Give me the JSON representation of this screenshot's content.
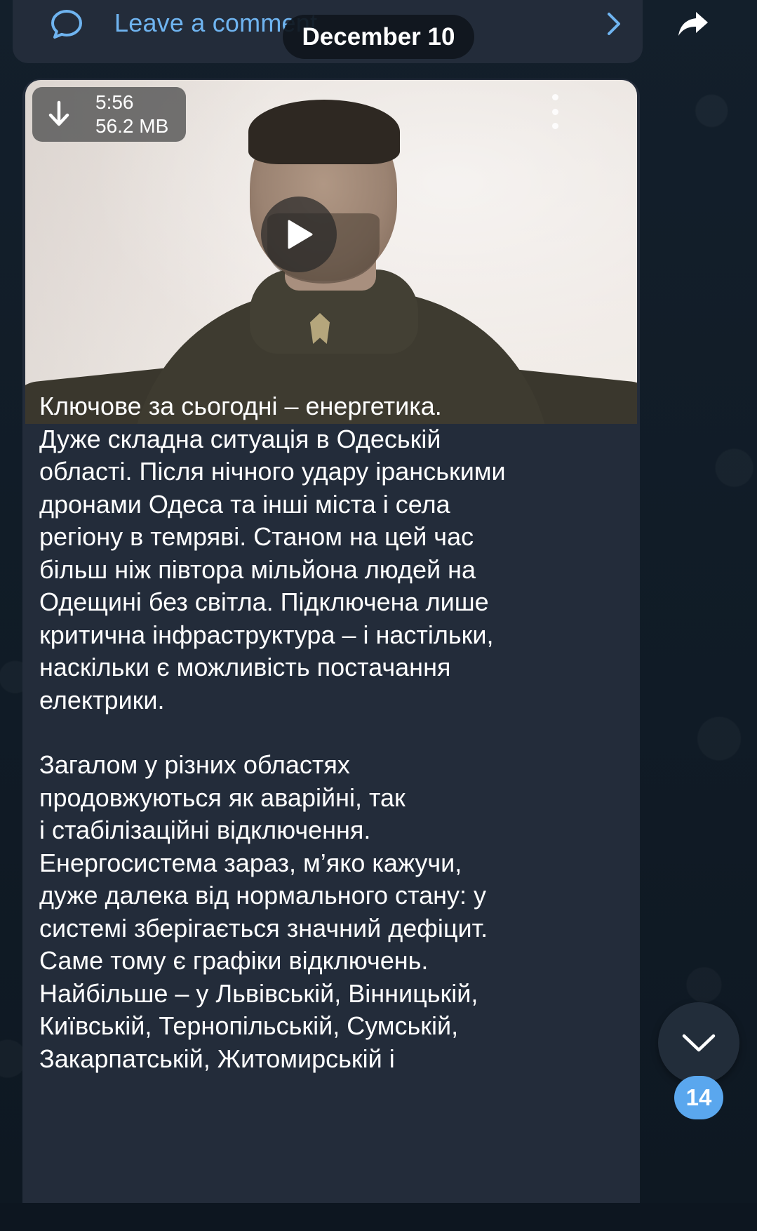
{
  "comments": {
    "label": "Leave a comment"
  },
  "date_separator": "December 10",
  "video": {
    "duration": "5:56",
    "size": "56.2 MB"
  },
  "message": {
    "paragraphs": [
      "Ключове за сьогодні – енергетика.\nДуже складна ситуація в Одеській\nобласті. Після нічного удару іранськими\nдронами Одеса та інші міста і села\nрегіону в темряві. Станом на цей час\nбільш ніж півтора мільйона людей на\nОдещині без світла. Підключена лише\nкритична інфраструктура – і настільки,\nнаскільки є можливість постачання\nелектрики.",
      "Загалом у різних областях\nпродовжуються як аварійні, так\nі стабілізаційні відключення.\nЕнергосистема зараз, м’яко кажучи,\nдуже далека від нормального стану: у\nсистемі зберігається значний дефіцит.\nСаме тому є графіки відключень.\nНайбільше – у Львівській, Вінницькій,\nКиївській, Тернопільській, Сумській,\nЗакарпатській, Житомирській і"
    ]
  },
  "scroll_down": {
    "unread_count": "14"
  },
  "colors": {
    "accent": "#6fb4f0",
    "bubble": "#232c3a",
    "badge": "#5aa7ee"
  },
  "icons": [
    "comment-icon",
    "chevron-right-icon",
    "share-icon",
    "download-icon",
    "play-icon",
    "more-icon",
    "chevron-down-icon"
  ]
}
